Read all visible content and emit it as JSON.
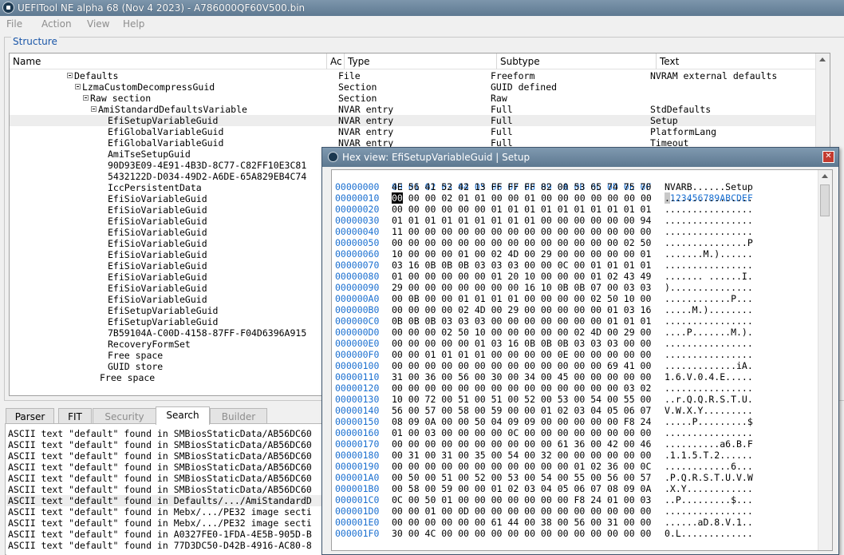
{
  "window": {
    "title": "UEFITool NE alpha 68 (Nov  4 2023) - A786000QF60V500.bin"
  },
  "menu": [
    "File",
    "Action",
    "View",
    "Help"
  ],
  "structure": {
    "label": "Structure",
    "columns": [
      "Name",
      "Ac",
      "Type",
      "Subtype",
      "Text"
    ],
    "rows": [
      {
        "name": "Defaults",
        "type": "File",
        "subtype": "Freeform",
        "text": "NVRAM external defaults",
        "expandable": true,
        "level": 0
      },
      {
        "name": "LzmaCustomDecompressGuid",
        "type": "Section",
        "subtype": "GUID defined",
        "text": "",
        "expandable": true,
        "level": 1
      },
      {
        "name": "Raw section",
        "type": "Section",
        "subtype": "Raw",
        "text": "",
        "expandable": true,
        "level": 2
      },
      {
        "name": "AmiStandardDefaultsVariable",
        "type": "NVAR entry",
        "subtype": "Full",
        "text": "StdDefaults",
        "expandable": true,
        "level": 3
      },
      {
        "name": "EfiSetupVariableGuid",
        "type": "NVAR entry",
        "subtype": "Full",
        "text": "Setup",
        "expandable": false,
        "level": 4,
        "selected": true
      },
      {
        "name": "EfiGlobalVariableGuid",
        "type": "NVAR entry",
        "subtype": "Full",
        "text": "PlatformLang",
        "expandable": false,
        "level": 4
      },
      {
        "name": "EfiGlobalVariableGuid",
        "type": "NVAR entry",
        "subtype": "Full",
        "text": "Timeout",
        "expandable": false,
        "level": 4
      },
      {
        "name": "AmiTseSetupGuid",
        "type": "",
        "subtype": "",
        "text": "",
        "expandable": false,
        "level": 4
      },
      {
        "name": "90D93E09-4E91-4B3D-8C77-C82FF10E3C81",
        "type": "",
        "subtype": "",
        "text": "",
        "expandable": false,
        "level": 4
      },
      {
        "name": "5432122D-D034-49D2-A6DE-65A829EB4C74",
        "type": "",
        "subtype": "",
        "text": "",
        "expandable": false,
        "level": 4
      },
      {
        "name": "IccPersistentData",
        "type": "",
        "subtype": "",
        "text": "",
        "expandable": false,
        "level": 4
      },
      {
        "name": "EfiSioVariableGuid",
        "type": "",
        "subtype": "",
        "text": "",
        "expandable": false,
        "level": 4
      },
      {
        "name": "EfiSioVariableGuid",
        "type": "",
        "subtype": "",
        "text": "",
        "expandable": false,
        "level": 4
      },
      {
        "name": "EfiSioVariableGuid",
        "type": "",
        "subtype": "",
        "text": "",
        "expandable": false,
        "level": 4
      },
      {
        "name": "EfiSioVariableGuid",
        "type": "",
        "subtype": "",
        "text": "",
        "expandable": false,
        "level": 4
      },
      {
        "name": "EfiSioVariableGuid",
        "type": "",
        "subtype": "",
        "text": "",
        "expandable": false,
        "level": 4
      },
      {
        "name": "EfiSioVariableGuid",
        "type": "",
        "subtype": "",
        "text": "",
        "expandable": false,
        "level": 4
      },
      {
        "name": "EfiSioVariableGuid",
        "type": "",
        "subtype": "",
        "text": "",
        "expandable": false,
        "level": 4
      },
      {
        "name": "EfiSioVariableGuid",
        "type": "",
        "subtype": "",
        "text": "",
        "expandable": false,
        "level": 4
      },
      {
        "name": "EfiSioVariableGuid",
        "type": "",
        "subtype": "",
        "text": "",
        "expandable": false,
        "level": 4
      },
      {
        "name": "EfiSioVariableGuid",
        "type": "",
        "subtype": "",
        "text": "",
        "expandable": false,
        "level": 4
      },
      {
        "name": "EfiSetupVariableGuid",
        "type": "",
        "subtype": "",
        "text": "",
        "expandable": false,
        "level": 4
      },
      {
        "name": "EfiSetupVariableGuid",
        "type": "",
        "subtype": "",
        "text": "",
        "expandable": false,
        "level": 4
      },
      {
        "name": "7B59104A-C00D-4158-87FF-F04D6396A915",
        "type": "",
        "subtype": "",
        "text": "",
        "expandable": false,
        "level": 4
      },
      {
        "name": "RecoveryFormSet",
        "type": "",
        "subtype": "",
        "text": "",
        "expandable": false,
        "level": 4
      },
      {
        "name": "Free space",
        "type": "",
        "subtype": "",
        "text": "",
        "expandable": false,
        "level": 4
      },
      {
        "name": "GUID store",
        "type": "",
        "subtype": "",
        "text": "",
        "expandable": false,
        "level": 4
      },
      {
        "name": "Free space",
        "type": "",
        "subtype": "",
        "text": "",
        "expandable": false,
        "level": 3
      }
    ]
  },
  "tabs": [
    {
      "label": "Parser",
      "state": "normal"
    },
    {
      "label": "FIT",
      "state": "normal"
    },
    {
      "label": "Security",
      "state": "disabled"
    },
    {
      "label": "Search",
      "state": "active"
    },
    {
      "label": "Builder",
      "state": "disabled"
    }
  ],
  "search_results": [
    "ASCII text \"default\" found in SMBiosStaticData/AB56DC60",
    "ASCII text \"default\" found in SMBiosStaticData/AB56DC60",
    "ASCII text \"default\" found in SMBiosStaticData/AB56DC60",
    "ASCII text \"default\" found in SMBiosStaticData/AB56DC60",
    "ASCII text \"default\" found in SMBiosStaticData/AB56DC60",
    "ASCII text \"default\" found in SMBiosStaticData/AB56DC60",
    "ASCII text \"default\" found in Defaults/.../AmiStandardD",
    "ASCII text \"default\" found in Mebx/.../PE32 image secti",
    "ASCII text \"default\" found in Mebx/.../PE32 image secti",
    "ASCII text \"default\" found in A0327FE0-1FDA-4E5B-905D-B",
    "ASCII text \"default\" found in 77D3DC50-D42B-4916-AC80-8"
  ],
  "search_selected_index": 6,
  "hex_view": {
    "title": "Hex view: EfiSetupVariableGuid | Setup",
    "header_bytes": "00 01 02 03 04 05 06 07 08 09 0A 0B 0C 0D 0E 0F",
    "header_ascii": "0123456789ABCDEF",
    "cursor": {
      "row": 1,
      "col": 0
    },
    "rows": [
      {
        "addr": "00000000",
        "bytes": "4E 56 41 52 42 13 FF FF FF 82 00 53 65 74 75 70",
        "ascii": "NVARB......Setup"
      },
      {
        "addr": "00000010",
        "bytes": "00 00 00 02 01 01 00 00 01 00 00 00 00 00 00 00",
        "ascii": "................"
      },
      {
        "addr": "00000020",
        "bytes": "00 00 00 00 00 00 01 01 01 01 01 01 01 01 01 01",
        "ascii": "................"
      },
      {
        "addr": "00000030",
        "bytes": "01 01 01 01 01 01 01 01 01 00 00 00 00 00 00 94",
        "ascii": "................"
      },
      {
        "addr": "00000040",
        "bytes": "11 00 00 00 00 00 00 00 00 00 00 00 00 00 00 00",
        "ascii": "................"
      },
      {
        "addr": "00000050",
        "bytes": "00 00 00 00 00 00 00 00 00 00 00 00 00 00 02 50",
        "ascii": "...............P"
      },
      {
        "addr": "00000060",
        "bytes": "10 00 00 00 01 00 02 4D 00 29 00 00 00 00 00 01",
        "ascii": ".......M.)......"
      },
      {
        "addr": "00000070",
        "bytes": "03 16 0B 0B 0B 03 03 03 00 00 0C 00 01 01 01 01",
        "ascii": "................"
      },
      {
        "addr": "00000080",
        "bytes": "01 00 00 00 00 00 01 20 10 00 00 00 01 02 43 49",
        "ascii": "....... ......I."
      },
      {
        "addr": "00000090",
        "bytes": "29 00 00 00 00 00 00 00 16 10 0B 0B 07 00 03 03",
        "ascii": ")..............."
      },
      {
        "addr": "000000A0",
        "bytes": "00 0B 00 00 01 01 01 01 00 00 00 00 02 50 10 00",
        "ascii": "............P..."
      },
      {
        "addr": "000000B0",
        "bytes": "00 00 00 00 02 4D 00 29 00 00 00 00 00 01 03 16",
        "ascii": ".....M.)........"
      },
      {
        "addr": "000000C0",
        "bytes": "0B 0B 0B 03 03 03 00 00 00 00 00 00 00 01 01 01",
        "ascii": "................"
      },
      {
        "addr": "000000D0",
        "bytes": "00 00 00 02 50 10 00 00 00 00 00 02 4D 00 29 00",
        "ascii": "....P.......M.)."
      },
      {
        "addr": "000000E0",
        "bytes": "00 00 00 00 00 01 03 16 0B 0B 0B 03 03 03 00 00",
        "ascii": "................"
      },
      {
        "addr": "000000F0",
        "bytes": "00 00 01 01 01 01 00 00 00 00 0E 00 00 00 00 00",
        "ascii": "................"
      },
      {
        "addr": "00000100",
        "bytes": "00 00 00 00 00 00 00 00 00 00 00 00 00 69 41 00",
        "ascii": ".............iA."
      },
      {
        "addr": "00000110",
        "bytes": "31 00 36 00 56 00 30 00 34 00 45 00 00 00 00 00",
        "ascii": "1.6.V.0.4.E....."
      },
      {
        "addr": "00000120",
        "bytes": "00 00 00 00 00 00 00 00 00 00 00 00 00 00 03 02",
        "ascii": "................"
      },
      {
        "addr": "00000130",
        "bytes": "10 00 72 00 51 00 51 00 52 00 53 00 54 00 55 00",
        "ascii": "..r.Q.Q.R.S.T.U."
      },
      {
        "addr": "00000140",
        "bytes": "56 00 57 00 58 00 59 00 00 01 02 03 04 05 06 07",
        "ascii": "V.W.X.Y........."
      },
      {
        "addr": "00000150",
        "bytes": "08 09 0A 00 00 50 04 09 09 00 00 00 00 00 F8 24",
        "ascii": ".....P.........$"
      },
      {
        "addr": "00000160",
        "bytes": "01 00 03 00 00 00 00 0C 00 00 00 00 00 00 00 00",
        "ascii": "................"
      },
      {
        "addr": "00000170",
        "bytes": "00 00 00 00 00 00 00 00 00 00 61 36 00 42 00 46",
        "ascii": "..........a6.B.F"
      },
      {
        "addr": "00000180",
        "bytes": "00 31 00 31 00 35 00 54 00 32 00 00 00 00 00 00",
        "ascii": ".1.1.5.T.2......"
      },
      {
        "addr": "00000190",
        "bytes": "00 00 00 00 00 00 00 00 00 00 00 01 02 36 00 0C",
        "ascii": "............6..."
      },
      {
        "addr": "000001A0",
        "bytes": "00 50 00 51 00 52 00 53 00 54 00 55 00 56 00 57",
        "ascii": ".P.Q.R.S.T.U.V.W"
      },
      {
        "addr": "000001B0",
        "bytes": "00 58 00 59 00 00 01 02 03 04 05 06 07 08 09 0A",
        "ascii": ".X.Y............"
      },
      {
        "addr": "000001C0",
        "bytes": "0C 00 50 01 00 00 00 00 00 00 00 F8 24 01 00 03",
        "ascii": "..P.........$..."
      },
      {
        "addr": "000001D0",
        "bytes": "00 00 01 00 0D 00 00 00 00 00 00 00 00 00 00 00",
        "ascii": "................"
      },
      {
        "addr": "000001E0",
        "bytes": "00 00 00 00 00 00 61 44 00 38 00 56 00 31 00 00",
        "ascii": "......aD.8.V.1.."
      },
      {
        "addr": "000001F0",
        "bytes": "30 00 4C 00 00 00 00 00 00 00 00 00 00 00 00 00",
        "ascii": "0.L............."
      }
    ]
  },
  "icons": {
    "app": "uefitool-icon",
    "close": "close-icon"
  }
}
